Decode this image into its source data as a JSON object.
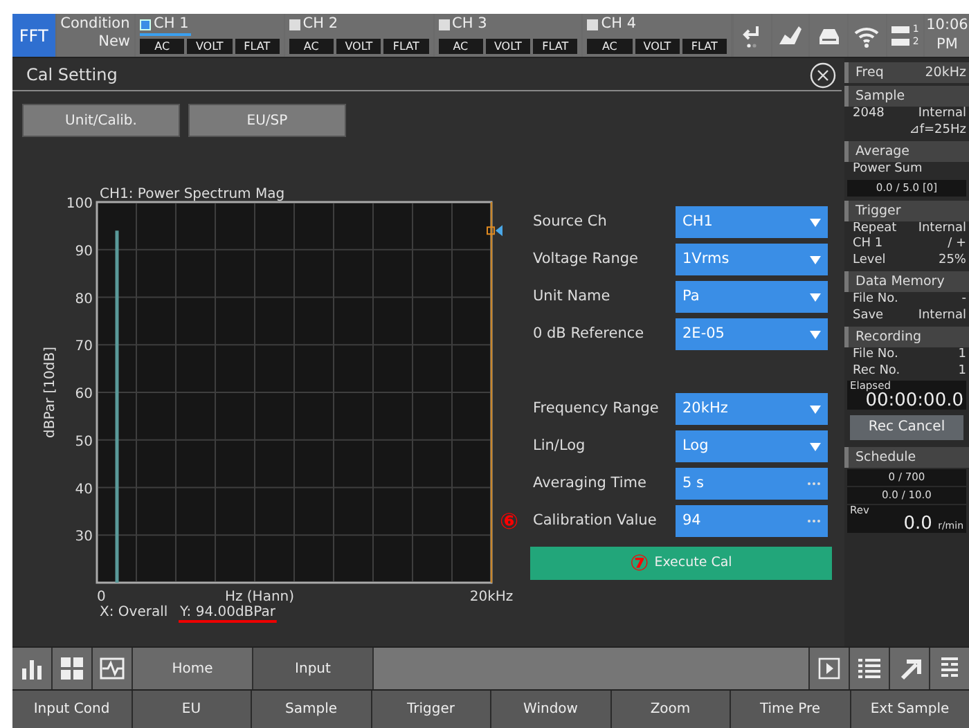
{
  "top_bar": {
    "mode": "FFT",
    "condition": {
      "label": "Condition",
      "sub": "New"
    },
    "channels": [
      {
        "name": "CH 1",
        "selected": true,
        "tags": [
          "AC",
          "VOLT",
          "FLAT"
        ]
      },
      {
        "name": "CH 2",
        "selected": false,
        "tags": [
          "AC",
          "VOLT",
          "FLAT"
        ]
      },
      {
        "name": "CH 3",
        "selected": false,
        "tags": [
          "AC",
          "VOLT",
          "FLAT"
        ]
      },
      {
        "name": "CH 4",
        "selected": false,
        "tags": [
          "AC",
          "VOLT",
          "FLAT"
        ]
      }
    ],
    "battery_labels": [
      "1",
      "2"
    ],
    "clock": [
      "10:06",
      "PM"
    ]
  },
  "panel": {
    "title": "Cal Setting",
    "tabs": [
      {
        "label": "Unit/Calib."
      },
      {
        "label": "EU/SP"
      }
    ],
    "chart_data": {
      "type": "bar",
      "title": "CH1: Power Spectrum Mag",
      "xlabel": "Hz (Hann)",
      "ylabel": "dBPar [10dB]",
      "x": [
        1
      ],
      "series": [
        {
          "color": "#5a9a9a",
          "values": [
            94
          ]
        }
      ],
      "grid": true,
      "xlim": [
        0,
        20
      ],
      "ylim": [
        20,
        100
      ],
      "xticks": [
        0,
        {
          "value": 20,
          "label": "20kHz"
        }
      ],
      "yticks": [
        30,
        40,
        50,
        60,
        70,
        80,
        90,
        100
      ]
    },
    "readout": {
      "x": "X: Overall",
      "y": "Y: 94.00dBPar",
      "y_underlined": true
    },
    "form_groups": [
      [
        {
          "label": "Source Ch",
          "value": "CH1",
          "kind": "dropdown"
        },
        {
          "label": "Voltage Range",
          "value": "1Vrms",
          "kind": "dropdown"
        },
        {
          "label": "Unit Name",
          "value": "Pa",
          "kind": "dropdown"
        },
        {
          "label": "0 dB Reference",
          "value": "2E-05",
          "kind": "dropdown"
        }
      ],
      [
        {
          "label": "Frequency Range",
          "value": "20kHz",
          "kind": "dropdown"
        },
        {
          "label": "Lin/Log",
          "value": "Log",
          "kind": "dropdown"
        },
        {
          "label": "Averaging Time",
          "value": "5 s",
          "kind": "dialog"
        },
        {
          "label": "Calibration Value",
          "value": "94",
          "kind": "dialog",
          "callout": "⑥"
        }
      ]
    ],
    "execute": {
      "label": "Execute Cal",
      "callout": "⑦"
    }
  },
  "sidebar": [
    {
      "title": "Freq",
      "value": "20kHz"
    },
    {
      "title": "Sample",
      "items": [
        {
          "kind": "row",
          "cells": [
            "2048",
            "Internal"
          ]
        },
        {
          "kind": "row",
          "cells": [
            "",
            "⊿f=25Hz"
          ]
        }
      ]
    },
    {
      "title": "Average",
      "items": [
        {
          "kind": "row",
          "cells": [
            "Power Sum",
            ""
          ]
        },
        {
          "kind": "meter",
          "text": "0.0 / 5.0 [0]"
        }
      ]
    },
    {
      "title": "Trigger",
      "items": [
        {
          "kind": "row",
          "cells": [
            "Repeat",
            "Internal"
          ]
        },
        {
          "kind": "row",
          "cells": [
            "CH 1",
            "/ +"
          ]
        },
        {
          "kind": "row",
          "cells": [
            "Level",
            "25%"
          ]
        }
      ]
    },
    {
      "title": "Data Memory",
      "items": [
        {
          "kind": "row",
          "cells": [
            "File No.",
            "-"
          ]
        },
        {
          "kind": "row",
          "cells": [
            "Save",
            "Internal"
          ]
        }
      ]
    },
    {
      "title": "Recording",
      "items": [
        {
          "kind": "row",
          "cells": [
            "File No.",
            "1"
          ]
        },
        {
          "kind": "row",
          "cells": [
            "Rec No.",
            "1"
          ]
        },
        {
          "kind": "readout",
          "label": "Elapsed",
          "value": "00:00:00.0"
        },
        {
          "kind": "button",
          "text": "Rec Cancel"
        }
      ]
    },
    {
      "title": "Schedule",
      "items": [
        {
          "kind": "meter",
          "text": "0 / 700"
        },
        {
          "kind": "meter",
          "text": "0.0 / 10.0"
        },
        {
          "kind": "readout",
          "label": "Rev",
          "value": "0.0",
          "unit": "r/min"
        }
      ]
    }
  ],
  "bottom_tabs": [
    {
      "label": "Home",
      "selected": false
    },
    {
      "label": "Input",
      "selected": true
    }
  ],
  "softkeys": [
    "Input Cond",
    "EU",
    "Sample",
    "Trigger",
    "Window",
    "Zoom",
    "Time Pre",
    "Ext Sample"
  ]
}
